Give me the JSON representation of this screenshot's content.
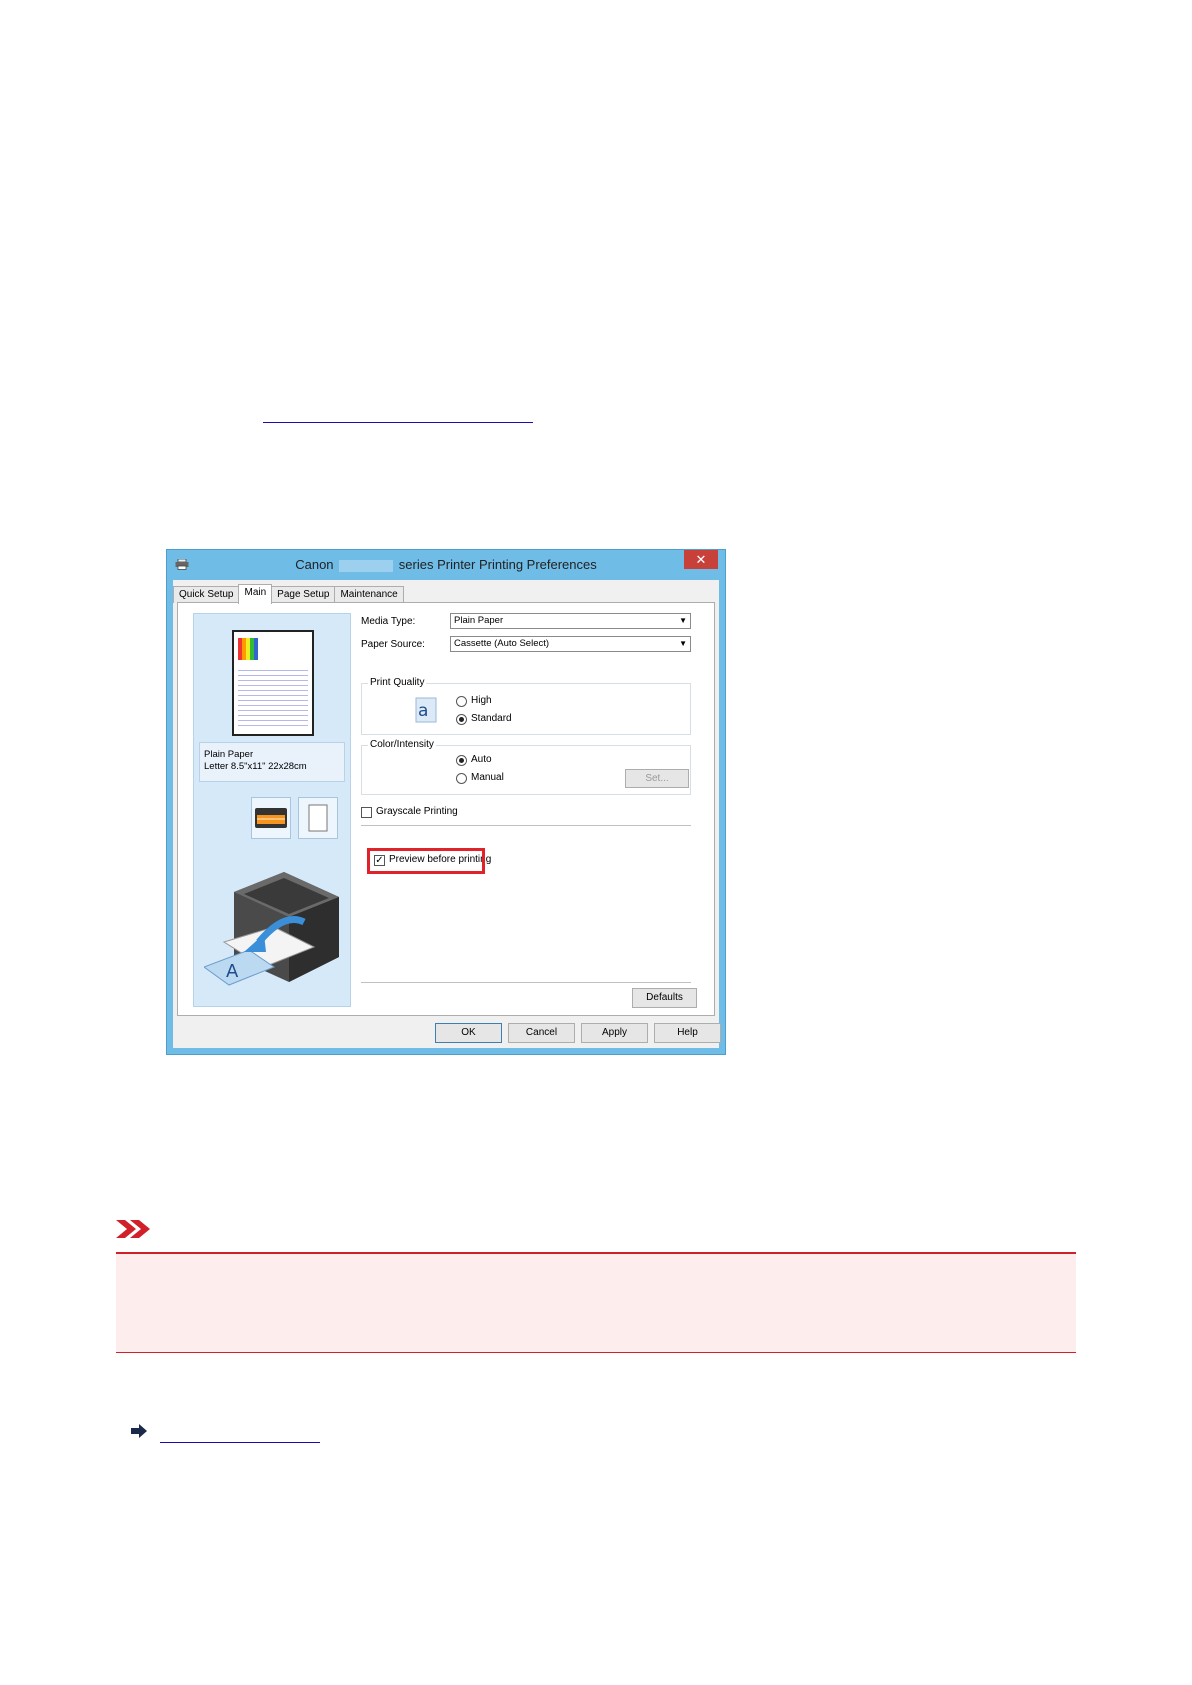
{
  "dialog": {
    "title_prefix": "Canon",
    "title_suffix": "series Printer Printing Preferences",
    "close_label": "✕",
    "tabs": [
      {
        "label": "Quick Setup",
        "active": false
      },
      {
        "label": "Main",
        "active": true
      },
      {
        "label": "Page Setup",
        "active": false
      },
      {
        "label": "Maintenance",
        "active": false
      }
    ],
    "preview": {
      "media_line1": "Plain Paper",
      "media_line2": "Letter 8.5\"x11\" 22x28cm"
    },
    "media_type": {
      "label": "Media Type:",
      "value": "Plain Paper"
    },
    "paper_source": {
      "label": "Paper Source:",
      "value": "Cassette (Auto Select)"
    },
    "print_quality": {
      "group_label": "Print Quality",
      "icon_glyph": "a",
      "options": [
        {
          "label": "High",
          "checked": false
        },
        {
          "label": "Standard",
          "checked": true
        }
      ]
    },
    "color_intensity": {
      "group_label": "Color/Intensity",
      "options": [
        {
          "label": "Auto",
          "checked": true
        },
        {
          "label": "Manual",
          "checked": false
        }
      ],
      "set_button": "Set..."
    },
    "grayscale": {
      "label": "Grayscale Printing",
      "checked": false
    },
    "preview_before_printing": {
      "label": "Preview before printing",
      "checked": true
    },
    "defaults_button": "Defaults",
    "buttons": {
      "ok": "OK",
      "cancel": "Cancel",
      "apply": "Apply",
      "help": "Help"
    }
  },
  "colors": {
    "title_bar": "#6fbce7",
    "highlight": "#e0232b",
    "note_border": "#d0202a",
    "note_bg": "#fdeeed",
    "link": "#1a0dab"
  },
  "icons": {
    "important": "important-double-chevron-icon",
    "reference": "arrow-right-icon",
    "printer": "printer-icon"
  }
}
